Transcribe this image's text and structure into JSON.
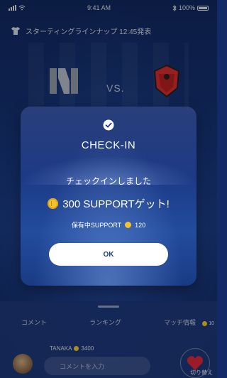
{
  "status_bar": {
    "time": "9:41 AM",
    "battery": "100%"
  },
  "lineup": {
    "text": "スターティングラインナップ 12:45発表"
  },
  "match": {
    "vs": "VS."
  },
  "panel": {
    "tabs": [
      "コメント",
      "ランキング",
      "マッチ情報"
    ],
    "user_name": "TANAKA",
    "user_points": "3400",
    "input_placeholder": "コメントを入力",
    "switch_label": "切り替え",
    "side_count": "10"
  },
  "modal": {
    "title": "CHECK-IN",
    "message": "チェックインしました",
    "reward": "300 SUPPORTゲット!",
    "held_label": "保有中SUPPORT",
    "held_value": "120",
    "ok_label": "OK"
  },
  "colors": {
    "coin": "#f2c32a",
    "accent": "#1d3a86",
    "heart": "#d9263a"
  }
}
